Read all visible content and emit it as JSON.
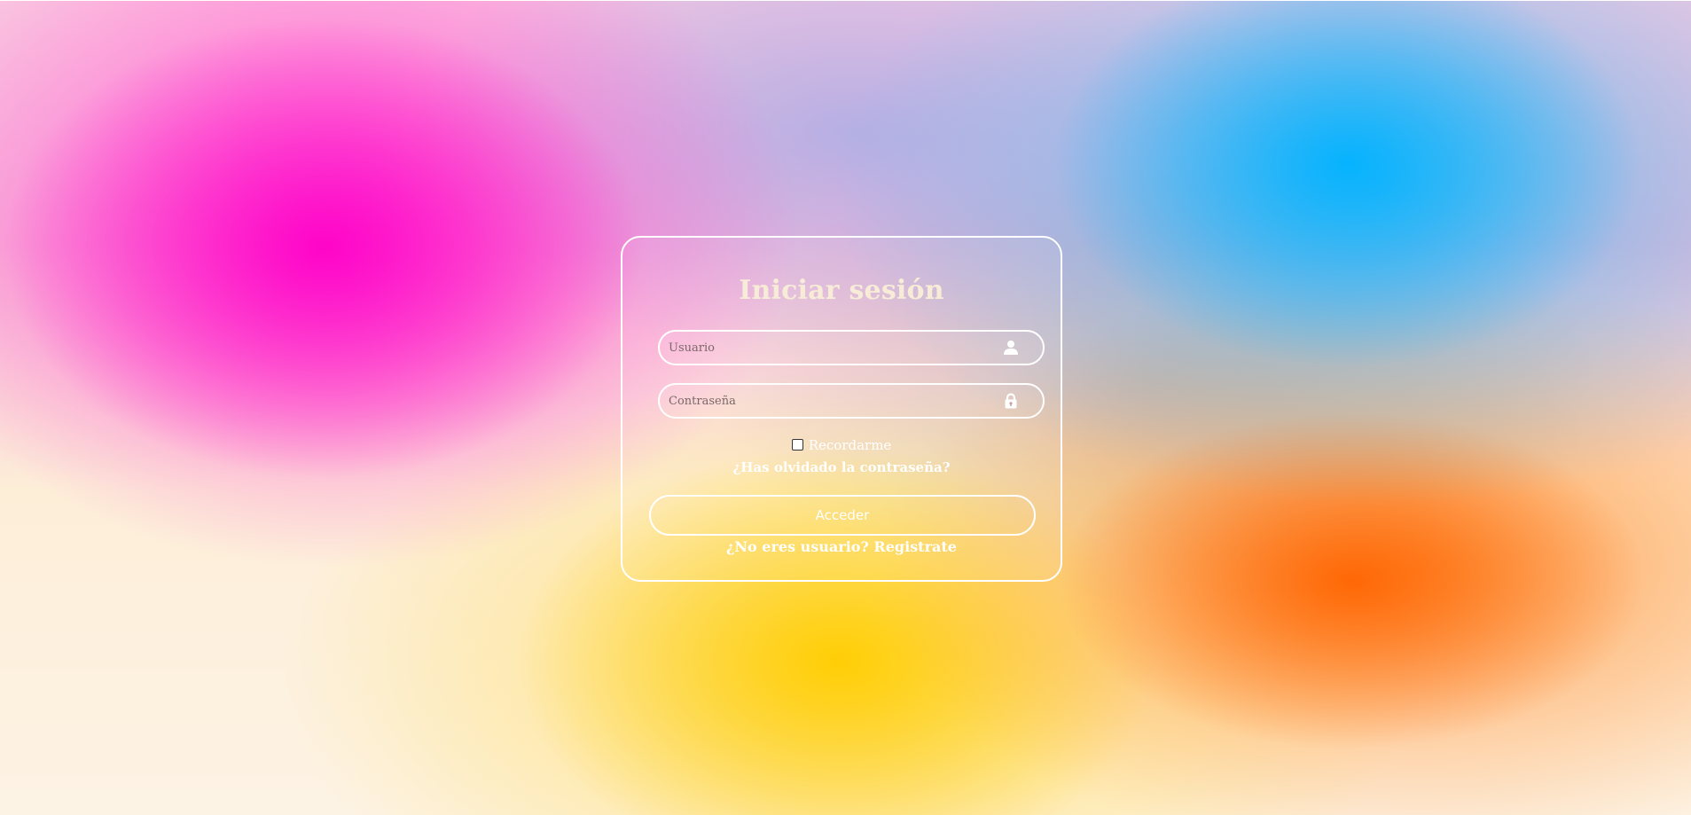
{
  "login": {
    "title": "Iniciar sesión",
    "username": {
      "value": "",
      "placeholder": "Usuario",
      "icon": "user-icon"
    },
    "password": {
      "value": "",
      "placeholder": "Contraseña",
      "icon": "lock-icon"
    },
    "remember": {
      "label": "Recordarme",
      "checked": false
    },
    "forgot_link": "¿Has olvidado la contraseña?",
    "submit_label": "Acceder",
    "register_link": "¿No eres usuario? Registrate"
  },
  "colors": {
    "card_border": "#ffffff",
    "title_text": "#f7ecd8",
    "bg_pink": "#ff00c8",
    "bg_blue": "#00b2ff",
    "bg_orange": "#ff6400",
    "bg_yellow": "#ffcd00",
    "bg_cream": "#fdf3e4"
  }
}
